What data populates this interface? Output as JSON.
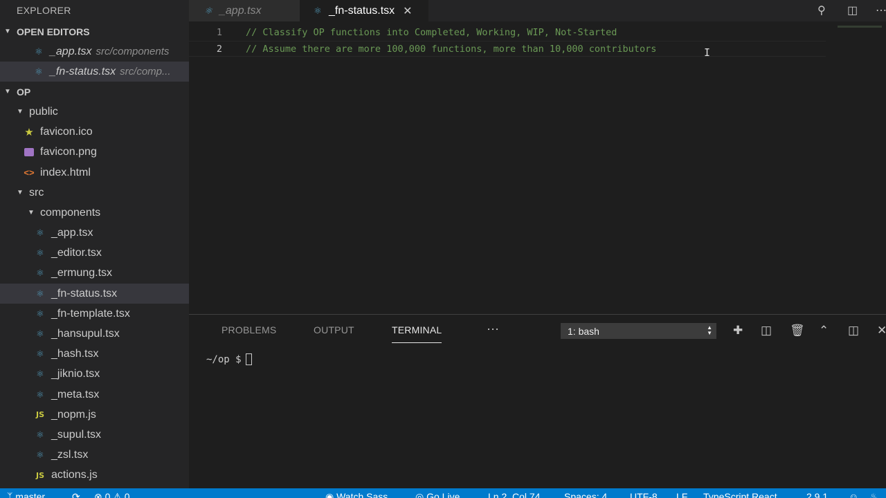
{
  "explorer": {
    "title": "EXPLORER",
    "open_editors": {
      "header": "OPEN EDITORS",
      "items": [
        {
          "name": "_app.tsx",
          "desc": "src/components"
        },
        {
          "name": "_fn-status.tsx",
          "desc": "src/comp..."
        }
      ]
    },
    "project": {
      "header": "OP",
      "public_folder": "public",
      "public_files": [
        "favicon.ico",
        "favicon.png",
        "index.html"
      ],
      "src_folder": "src",
      "components_folder": "components",
      "component_files": [
        "_app.tsx",
        "_editor.tsx",
        "_ermung.tsx",
        "_fn-status.tsx",
        "_fn-template.tsx",
        "_hansupul.tsx",
        "_hash.tsx",
        "_jiknio.tsx",
        "_meta.tsx",
        "_nopm.js",
        "_supul.tsx",
        "_zsl.tsx"
      ],
      "src_files": [
        "actions.js"
      ]
    }
  },
  "tabs": [
    {
      "label": "_app.tsx",
      "active": false
    },
    {
      "label": "_fn-status.tsx",
      "active": true
    }
  ],
  "editor": {
    "lines": [
      {
        "num": "1",
        "text": "// Classify OP functions into Completed, Working, WIP, Not-Started"
      },
      {
        "num": "2",
        "text": "// Assume there are more 100,000 functions, more than 10,000 contributors"
      }
    ]
  },
  "panel": {
    "tabs": [
      "PROBLEMS",
      "OUTPUT",
      "TERMINAL"
    ],
    "active_tab": "TERMINAL",
    "more": "···",
    "terminal_select": "1: bash",
    "prompt": "~/op $"
  },
  "statusbar": {
    "branch": "master",
    "errors": "0",
    "warnings": "0",
    "watch_sass": "Watch Sass",
    "go_live": "Go Live",
    "position": "Ln 2, Col 74",
    "spaces": "Spaces: 4",
    "encoding": "UTF-8",
    "eol": "LF",
    "language": "TypeScript React",
    "version": "2.9.1"
  },
  "colors": {
    "accent": "#007acc",
    "comment": "#6a9955",
    "react_icon": "#519aba"
  }
}
